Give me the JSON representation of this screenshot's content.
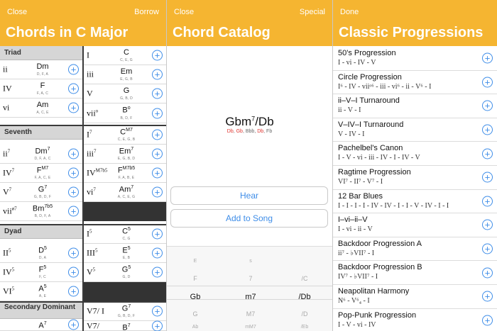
{
  "panel1": {
    "nav_left": "Close",
    "nav_right": "Borrow",
    "title": "Chords in C Major",
    "sections": {
      "triad": "Triad",
      "seventh": "Seventh",
      "dyad": "Dyad",
      "secondary": "Secondary Dominant"
    },
    "colA": [
      {
        "rn": "ii",
        "sup": "",
        "name": "Dm",
        "nsup": "",
        "notes": "D, F, A"
      },
      {
        "rn": "IV",
        "sup": "",
        "name": "F",
        "nsup": "",
        "notes": "F, A, C"
      },
      {
        "rn": "vi",
        "sup": "",
        "name": "Am",
        "nsup": "",
        "notes": "A, C, E"
      },
      {
        "rn": "ii",
        "sup": "7",
        "name": "Dm",
        "nsup": "7",
        "notes": "D, F, A, C"
      },
      {
        "rn": "IV",
        "sup": "7",
        "name": "F",
        "nsup": "M7",
        "notes": "F, A, C, E"
      },
      {
        "rn": "V",
        "sup": "7",
        "name": "G",
        "nsup": "7",
        "notes": "G, B, D, F"
      },
      {
        "rn": "vii",
        "sup": "ø7",
        "name": "Bm",
        "nsup": "7b5",
        "notes": "B, D, F, A"
      },
      {
        "rn": "II",
        "sup": "5",
        "name": "D",
        "nsup": "5",
        "notes": "D, A"
      },
      {
        "rn": "IV",
        "sup": "5",
        "name": "F",
        "nsup": "5",
        "notes": "F, C"
      },
      {
        "rn": "VI",
        "sup": "5",
        "name": "A",
        "nsup": "5",
        "notes": "A, E"
      },
      {
        "rn": "",
        "sup": "",
        "name": "A",
        "nsup": "7",
        "notes": ""
      }
    ],
    "colB": [
      {
        "rn": "I",
        "sup": "",
        "name": "C",
        "nsup": "",
        "notes": "C, E, G"
      },
      {
        "rn": "iii",
        "sup": "",
        "name": "Em",
        "nsup": "",
        "notes": "E, G, B"
      },
      {
        "rn": "V",
        "sup": "",
        "name": "G",
        "nsup": "",
        "notes": "G, B, D"
      },
      {
        "rn": "vii",
        "sup": "o",
        "name": "B",
        "nsup": "o",
        "notes": "B, D, F"
      },
      {
        "rn": "I",
        "sup": "7",
        "name": "C",
        "nsup": "M7",
        "notes": "C, E, G, B"
      },
      {
        "rn": "iii",
        "sup": "7",
        "name": "Em",
        "nsup": "7",
        "notes": "E, G, B, D"
      },
      {
        "rn": "IV",
        "sup": "M7b5",
        "name": "F",
        "nsup": "M7b5",
        "notes": "F, A, B, E"
      },
      {
        "rn": "vi",
        "sup": "7",
        "name": "Am",
        "nsup": "7",
        "notes": "A, C, E, G"
      },
      {
        "rn": "I",
        "sup": "5",
        "name": "C",
        "nsup": "5",
        "notes": "C, G"
      },
      {
        "rn": "III",
        "sup": "5",
        "name": "E",
        "nsup": "5",
        "notes": "E, B"
      },
      {
        "rn": "V",
        "sup": "5",
        "name": "G",
        "nsup": "5",
        "notes": "G, D"
      },
      {
        "rn": "V7/ I",
        "sup": "",
        "name": "G",
        "nsup": "7",
        "notes": "G, B, D, F"
      },
      {
        "rn": "V7/",
        "sup": "",
        "name": "B",
        "nsup": "7",
        "notes": ""
      }
    ]
  },
  "panel2": {
    "nav_left": "Close",
    "nav_right": "Special",
    "title": "Chord Catalog",
    "chord_root": "Gbm",
    "chord_sup": "7",
    "chord_bass": "/Db",
    "notes": [
      {
        "t": "Db",
        "hl": true
      },
      {
        "t": "Gb",
        "hl": true
      },
      {
        "t": "Bbb",
        "hl": false
      },
      {
        "t": "Db",
        "hl": true
      },
      {
        "t": "Fb",
        "hl": false
      }
    ],
    "hear": "Hear",
    "add": "Add to Song",
    "picker": {
      "root": [
        "E",
        "F",
        "Gb",
        "G",
        "Ab"
      ],
      "quality": [
        "s",
        "7",
        "m7",
        "M7",
        "mM7"
      ],
      "bass": [
        "",
        "/C",
        "/Db",
        "/D",
        "/Eb"
      ]
    }
  },
  "panel3": {
    "nav_left": "Done",
    "title": "Classic Progressions",
    "items": [
      {
        "name": "50's Progression",
        "seq": "I - vi - IV - V"
      },
      {
        "name": "Circle Progression",
        "seq": "I⁶ - IV - viiᵒ⁶ - iii - vi⁶ - ii - V⁶ - I"
      },
      {
        "name": "ii–V–I Turnaround",
        "seq": "ii - V - I"
      },
      {
        "name": "V–IV–I Turnaround",
        "seq": "V - IV - I"
      },
      {
        "name": "Pachelbel's Canon",
        "seq": "I - V - vi - iii - IV - I - IV - V"
      },
      {
        "name": "Ragtime Progression",
        "seq": "VI⁷ - II⁷ - V⁷ - I"
      },
      {
        "name": "12 Bar Blues",
        "seq": "I - I - I - I - IV - IV - I - I - V - IV - I - I"
      },
      {
        "name": "I–vi–ii–V",
        "seq": "I - vi - ii - V"
      },
      {
        "name": "Backdoor Progression A",
        "seq": "ii⁷ - ♭VII⁷ - I"
      },
      {
        "name": "Backdoor Progression B",
        "seq": "IV⁷ - ♭VII⁷ - I"
      },
      {
        "name": "Neapolitan Harmony",
        "seq": "N⁶ - V⁶₄ - I"
      },
      {
        "name": "Pop-Punk Progression",
        "seq": "I - V - vi - IV"
      }
    ]
  },
  "colors": {
    "header": "#f5b531",
    "accent": "#3e8de8",
    "highlight_note": "#e0322d"
  }
}
